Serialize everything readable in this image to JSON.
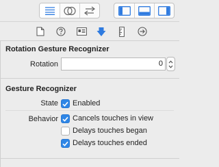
{
  "toolbar": {
    "group1": [
      "list-icon",
      "venn-icon",
      "arrows-swap-icon"
    ],
    "group2": [
      "left-panel-icon",
      "bottom-panel-icon",
      "right-panel-icon"
    ]
  },
  "inspector_tabs": [
    "file-icon",
    "help-icon",
    "identity-icon",
    "attributes-icon",
    "size-icon",
    "connections-icon"
  ],
  "rotation_section": {
    "title": "Rotation Gesture Recognizer",
    "rotation_label": "Rotation",
    "rotation_value": "0"
  },
  "gesture_section": {
    "title": "Gesture Recognizer",
    "state_label": "State",
    "enabled_label": "Enabled",
    "behavior_label": "Behavior",
    "behaviors": [
      {
        "label": "Cancels touches in view",
        "checked": true
      },
      {
        "label": "Delays touches began",
        "checked": false
      },
      {
        "label": "Delays touches ended",
        "checked": true
      }
    ]
  },
  "colors": {
    "accent": "#2e86e6",
    "selected_tab": "#2f7be0",
    "background": "#ececec"
  }
}
